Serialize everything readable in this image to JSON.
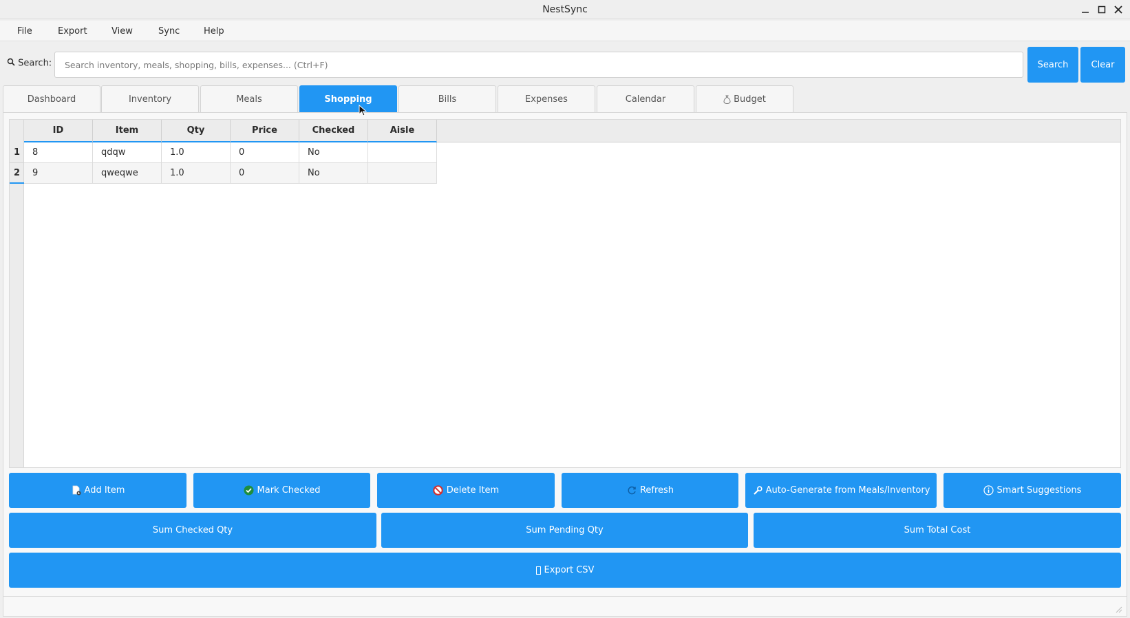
{
  "window": {
    "title": "NestSync"
  },
  "menu": [
    "File",
    "Export",
    "View",
    "Sync",
    "Help"
  ],
  "search": {
    "label": "Search:",
    "placeholder": "Search inventory, meals, shopping, bills, expenses... (Ctrl+F)",
    "value": "",
    "search_button": "Search",
    "clear_button": "Clear"
  },
  "tabs": [
    "Dashboard",
    "Inventory",
    "Meals",
    "Shopping",
    "Bills",
    "Expenses",
    "Calendar",
    "Budget"
  ],
  "active_tab": "Shopping",
  "table": {
    "columns": [
      "ID",
      "Item",
      "Qty",
      "Price",
      "Checked",
      "Aisle"
    ],
    "row_numbers": [
      "1",
      "2"
    ],
    "rows": [
      [
        "8",
        "qdqw",
        "1.0",
        "0",
        "No",
        ""
      ],
      [
        "9",
        "qweqwe",
        "1.0",
        "0",
        "No",
        ""
      ]
    ]
  },
  "actions": {
    "add_item": "Add Item",
    "mark_checked": "Mark Checked",
    "delete_item": "Delete Item",
    "refresh": "Refresh",
    "auto_generate": "Auto-Generate from Meals/Inventory",
    "smart_suggestions": "Smart Suggestions",
    "sum_checked": "Sum Checked Qty",
    "sum_pending": "Sum Pending Qty",
    "sum_total": "Sum Total Cost",
    "export_csv": "Export CSV"
  },
  "colors": {
    "accent": "#2196f3",
    "background": "#efefef"
  }
}
